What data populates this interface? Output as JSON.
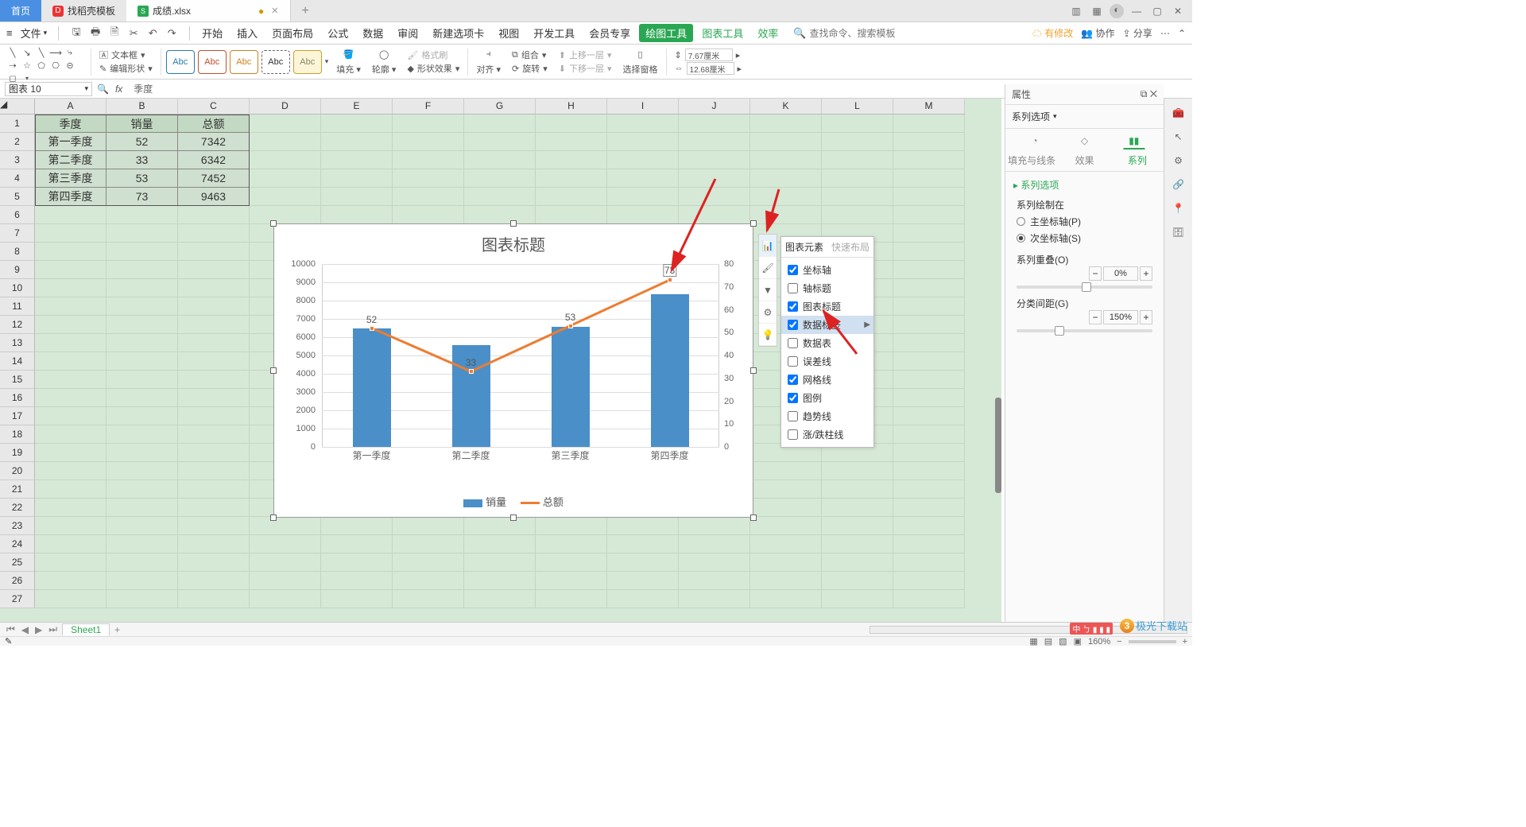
{
  "titlebar": {
    "home": "首页",
    "tab2": "找稻壳模板",
    "tab3": "成绩.xlsx",
    "plus": "+"
  },
  "menu": {
    "file": "文件",
    "items": [
      "开始",
      "插入",
      "页面布局",
      "公式",
      "数据",
      "审阅",
      "新建选项卡",
      "视图",
      "开发工具",
      "会员专享"
    ],
    "active": "绘图工具",
    "green_items": [
      "图表工具",
      "效率"
    ],
    "search_ph": "查找命令、搜索模板",
    "save_tip": "有修改",
    "coop": "协作",
    "share": "分享"
  },
  "ribbon": {
    "text_box": "文本框",
    "edit_shape": "编辑形状",
    "abc": "Abc",
    "fill": "填充",
    "outline": "轮廓",
    "shape_effect": "形状效果",
    "format_painter": "格式刷",
    "align": "对齐",
    "group": "组合",
    "rotate": "旋转",
    "bring_fwd": "上移一层",
    "send_back": "下移一层",
    "sel_pane": "选择窗格",
    "size1": "7.67厘米",
    "size2": "12.68厘米"
  },
  "fbar": {
    "name": "图表 10",
    "fx": "fx",
    "val": "季度"
  },
  "sheet": {
    "cols": [
      "A",
      "B",
      "C",
      "D",
      "E",
      "F",
      "G",
      "H",
      "I",
      "J",
      "K",
      "L",
      "M"
    ],
    "rows": 27,
    "headers": [
      "季度",
      "销量",
      "总额"
    ],
    "data": [
      [
        "第一季度",
        "52",
        "7342"
      ],
      [
        "第二季度",
        "33",
        "6342"
      ],
      [
        "第三季度",
        "53",
        "7452"
      ],
      [
        "第四季度",
        "73",
        "9463"
      ]
    ]
  },
  "chart_data": {
    "type": "bar+line",
    "title": "图表标题",
    "categories": [
      "第一季度",
      "第二季度",
      "第三季度",
      "第四季度"
    ],
    "series": [
      {
        "name": "销量",
        "type": "bar",
        "axis": "secondary",
        "values": [
          52,
          33,
          53,
          73
        ]
      },
      {
        "name": "总额",
        "type": "line",
        "axis": "primary",
        "values": [
          7342,
          6342,
          7452,
          9463
        ]
      }
    ],
    "data_labels_series": "销量",
    "data_labels": [
      "52",
      "33",
      "53",
      "73"
    ],
    "ylim": [
      0,
      10000
    ],
    "yticks": [
      0,
      1000,
      2000,
      3000,
      4000,
      5000,
      6000,
      7000,
      8000,
      9000,
      10000
    ],
    "y2lim": [
      0,
      80
    ],
    "y2ticks": [
      0,
      10,
      20,
      30,
      40,
      50,
      60,
      70,
      80
    ],
    "legend": [
      "销量",
      "总额"
    ]
  },
  "chart_popup": {
    "tab1": "图表元素",
    "tab2": "快速布局",
    "items": [
      {
        "label": "坐标轴",
        "checked": true
      },
      {
        "label": "轴标题",
        "checked": false
      },
      {
        "label": "图表标题",
        "checked": true
      },
      {
        "label": "数据标签",
        "checked": true,
        "sel": true,
        "arrow": true
      },
      {
        "label": "数据表",
        "checked": false
      },
      {
        "label": "误差线",
        "checked": false
      },
      {
        "label": "网格线",
        "checked": true
      },
      {
        "label": "图例",
        "checked": true
      },
      {
        "label": "趋势线",
        "checked": false
      },
      {
        "label": "涨/跌柱线",
        "checked": false
      }
    ]
  },
  "props": {
    "title": "属性",
    "dropdown": "系列选项",
    "tabs": [
      "填充与线条",
      "效果",
      "系列"
    ],
    "sec": "系列选项",
    "lbl_axis": "系列绘制在",
    "r1": "主坐标轴(P)",
    "r2": "次坐标轴(S)",
    "overlap_lbl": "系列重叠(O)",
    "overlap_val": "0%",
    "gap_lbl": "分类间距(G)",
    "gap_val": "150%"
  },
  "sheettab": "Sheet1",
  "zoom": "160%",
  "watermark": "极光下载站"
}
